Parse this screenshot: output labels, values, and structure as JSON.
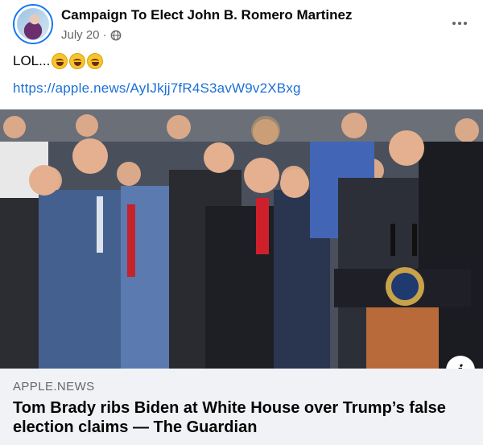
{
  "post": {
    "page_name": "Campaign To Elect John B. Romero Martinez",
    "date": "July 20",
    "separator": "·",
    "text": "LOL...",
    "emojis": [
      "rolling-on-floor-laughing",
      "rolling-on-floor-laughing",
      "rolling-on-floor-laughing"
    ],
    "link": "https://apple.news/AyIJkjj7fR4S3avW9v2XBxg"
  },
  "link_card": {
    "domain": "APPLE.NEWS",
    "title": "Tom Brady ribs Biden at White House over Trump’s false election claims — The Guardian",
    "info_label": "i"
  },
  "icons": {
    "privacy": "globe-icon",
    "more": "more-options-icon",
    "info": "info-icon"
  },
  "colors": {
    "link": "#1b6fd8",
    "secondary_text": "#65676b",
    "caption_bg": "#f0f2f5",
    "avatar_ring": "#1877f2"
  }
}
